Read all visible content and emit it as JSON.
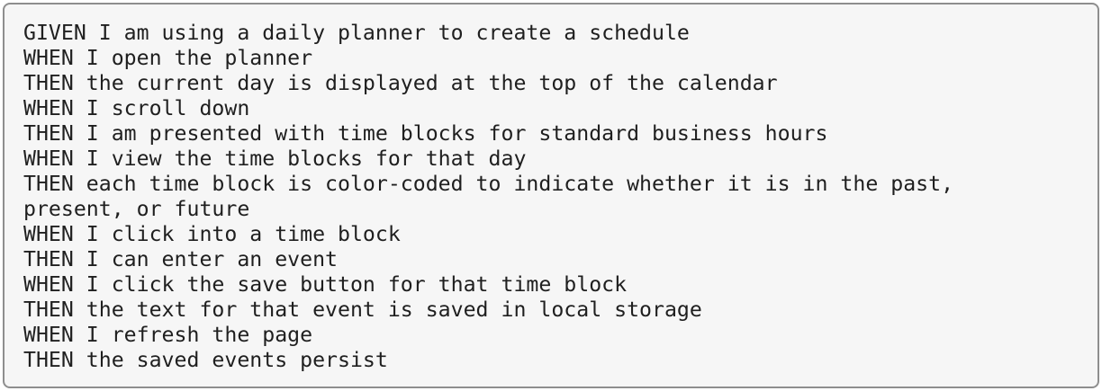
{
  "code_block": {
    "lines": [
      "GIVEN I am using a daily planner to create a schedule",
      "WHEN I open the planner",
      "THEN the current day is displayed at the top of the calendar",
      "WHEN I scroll down",
      "THEN I am presented with time blocks for standard business hours",
      "WHEN I view the time blocks for that day",
      "THEN each time block is color-coded to indicate whether it is in the past,",
      "present, or future",
      "WHEN I click into a time block",
      "THEN I can enter an event",
      "WHEN I click the save button for that time block",
      "THEN the text for that event is saved in local storage",
      "WHEN I refresh the page",
      "THEN the saved events persist"
    ]
  }
}
